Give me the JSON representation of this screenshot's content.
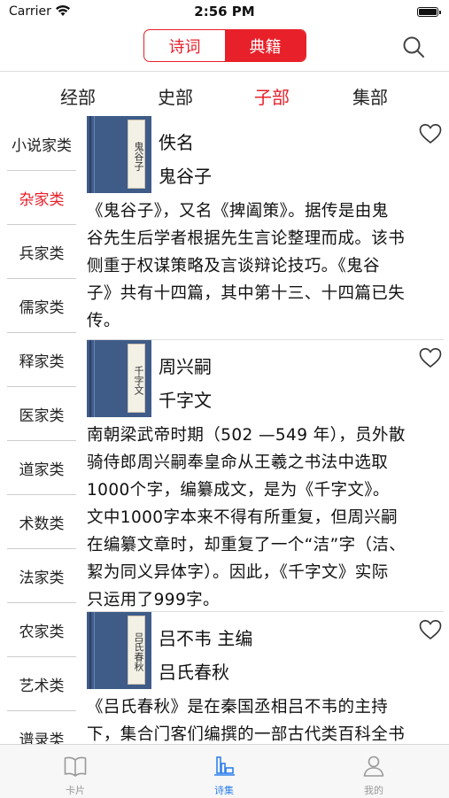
{
  "status": {
    "carrier": "Carrier",
    "time": "2:56 PM"
  },
  "header": {
    "segments": [
      {
        "label": "诗词",
        "selected": false
      },
      {
        "label": "典籍",
        "selected": true
      }
    ],
    "search_icon": "search-icon",
    "accent_color": "#e8202a"
  },
  "categories": [
    "经部",
    "史部",
    "子部",
    "集部"
  ],
  "selected_category": "子部",
  "sidebar": {
    "items": [
      "小说家类",
      "杂家类",
      "兵家类",
      "儒家类",
      "释家类",
      "医家类",
      "道家类",
      "术数类",
      "法家类",
      "农家类",
      "艺术类",
      "谱录类"
    ],
    "selected": "杂家类"
  },
  "entries": [
    {
      "cover_label": "鬼谷子",
      "author": "佚名",
      "title": "鬼谷子",
      "desc_lines": [
        "《鬼谷子》，又名《捭阖策》。据传是由鬼",
        "谷先生后学者根据先生言论整理而成。该书",
        "侧重于权谋策略及言谈辩论技巧。《鬼谷",
        "子》共有十四篇，其中第十三、十四篇已失",
        "传。"
      ]
    },
    {
      "cover_label": "千字文",
      "author": "周兴嗣",
      "title": "千字文",
      "desc_lines": [
        "南朝梁武帝时期（502 —549 年），员外散",
        "骑侍郎周兴嗣奉皇命从王羲之书法中选取",
        "1000个字，编纂成文，是为《千字文》。",
        "文中1000字本来不得有所重复，但周兴嗣",
        "在编纂文章时，却重复了一个“洁”字（洁、",
        "絜为同义异体字）。因此，《千字文》实际",
        "只运用了999字。"
      ]
    },
    {
      "cover_label": "吕氏春秋",
      "author": "吕不韦 主编",
      "title": "吕氏春秋",
      "desc_lines": [
        "《吕氏春秋》是在秦国丞相吕不韦的主持",
        "下，集合门客们编撰的一部古代类百科全书"
      ]
    }
  ],
  "tabbar": {
    "tabs": [
      {
        "label": "卡片",
        "icon": "book-icon",
        "selected": false
      },
      {
        "label": "诗集",
        "icon": "collection-icon",
        "selected": true
      },
      {
        "label": "我的",
        "icon": "person-icon",
        "selected": false
      }
    ],
    "active_color": "#2f80ed"
  }
}
